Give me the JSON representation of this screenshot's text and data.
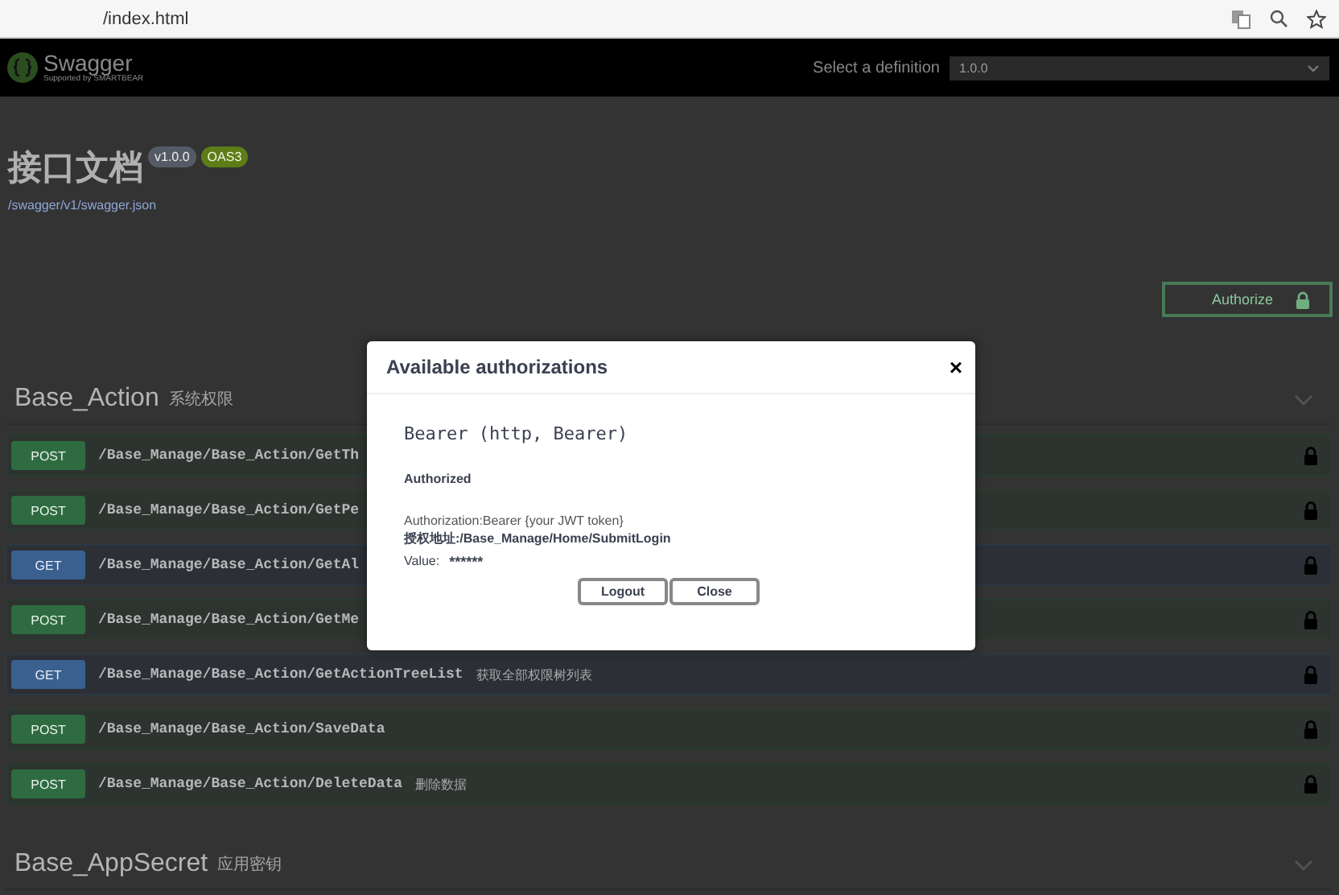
{
  "browser": {
    "url": "/index.html"
  },
  "topbar": {
    "logo_text": "Swagger",
    "logo_subtitle": "Supported by SMARTBEAR",
    "definition_label": "Select a definition",
    "definition_value": "1.0.0"
  },
  "info": {
    "title": "接口文档",
    "version_badge": "v1.0.0",
    "oas_badge": "OAS3",
    "spec_link": "/swagger/v1/swagger.json"
  },
  "authorize_button": "Authorize",
  "sections": [
    {
      "name": "Base_Action",
      "description": "系统权限",
      "operations": [
        {
          "method": "POST",
          "kind": "post",
          "path": "/Base_Manage/Base_Action/GetTh"
        },
        {
          "method": "POST",
          "kind": "post",
          "path": "/Base_Manage/Base_Action/GetPe"
        },
        {
          "method": "GET",
          "kind": "get",
          "path": "/Base_Manage/Base_Action/GetAl"
        },
        {
          "method": "POST",
          "kind": "post",
          "path": "/Base_Manage/Base_Action/GetMe"
        },
        {
          "method": "GET",
          "kind": "get",
          "path": "/Base_Manage/Base_Action/GetActionTreeList",
          "summary": "获取全部权限树列表"
        },
        {
          "method": "POST",
          "kind": "post",
          "path": "/Base_Manage/Base_Action/SaveData"
        },
        {
          "method": "POST",
          "kind": "post",
          "path": "/Base_Manage/Base_Action/DeleteData",
          "summary": "删除数据"
        }
      ]
    },
    {
      "name": "Base_AppSecret",
      "description": "应用密钥"
    }
  ],
  "modal": {
    "title": "Available authorizations",
    "close": "×",
    "scheme_title": "Bearer  (http, Bearer)",
    "status": "Authorized",
    "description": "Authorization:Bearer {your JWT token}",
    "auth_url": "授权地址:/Base_Manage/Home/SubmitLogin",
    "value_label": "Value:",
    "value": "******",
    "buttons": [
      "Logout",
      "Close"
    ]
  }
}
